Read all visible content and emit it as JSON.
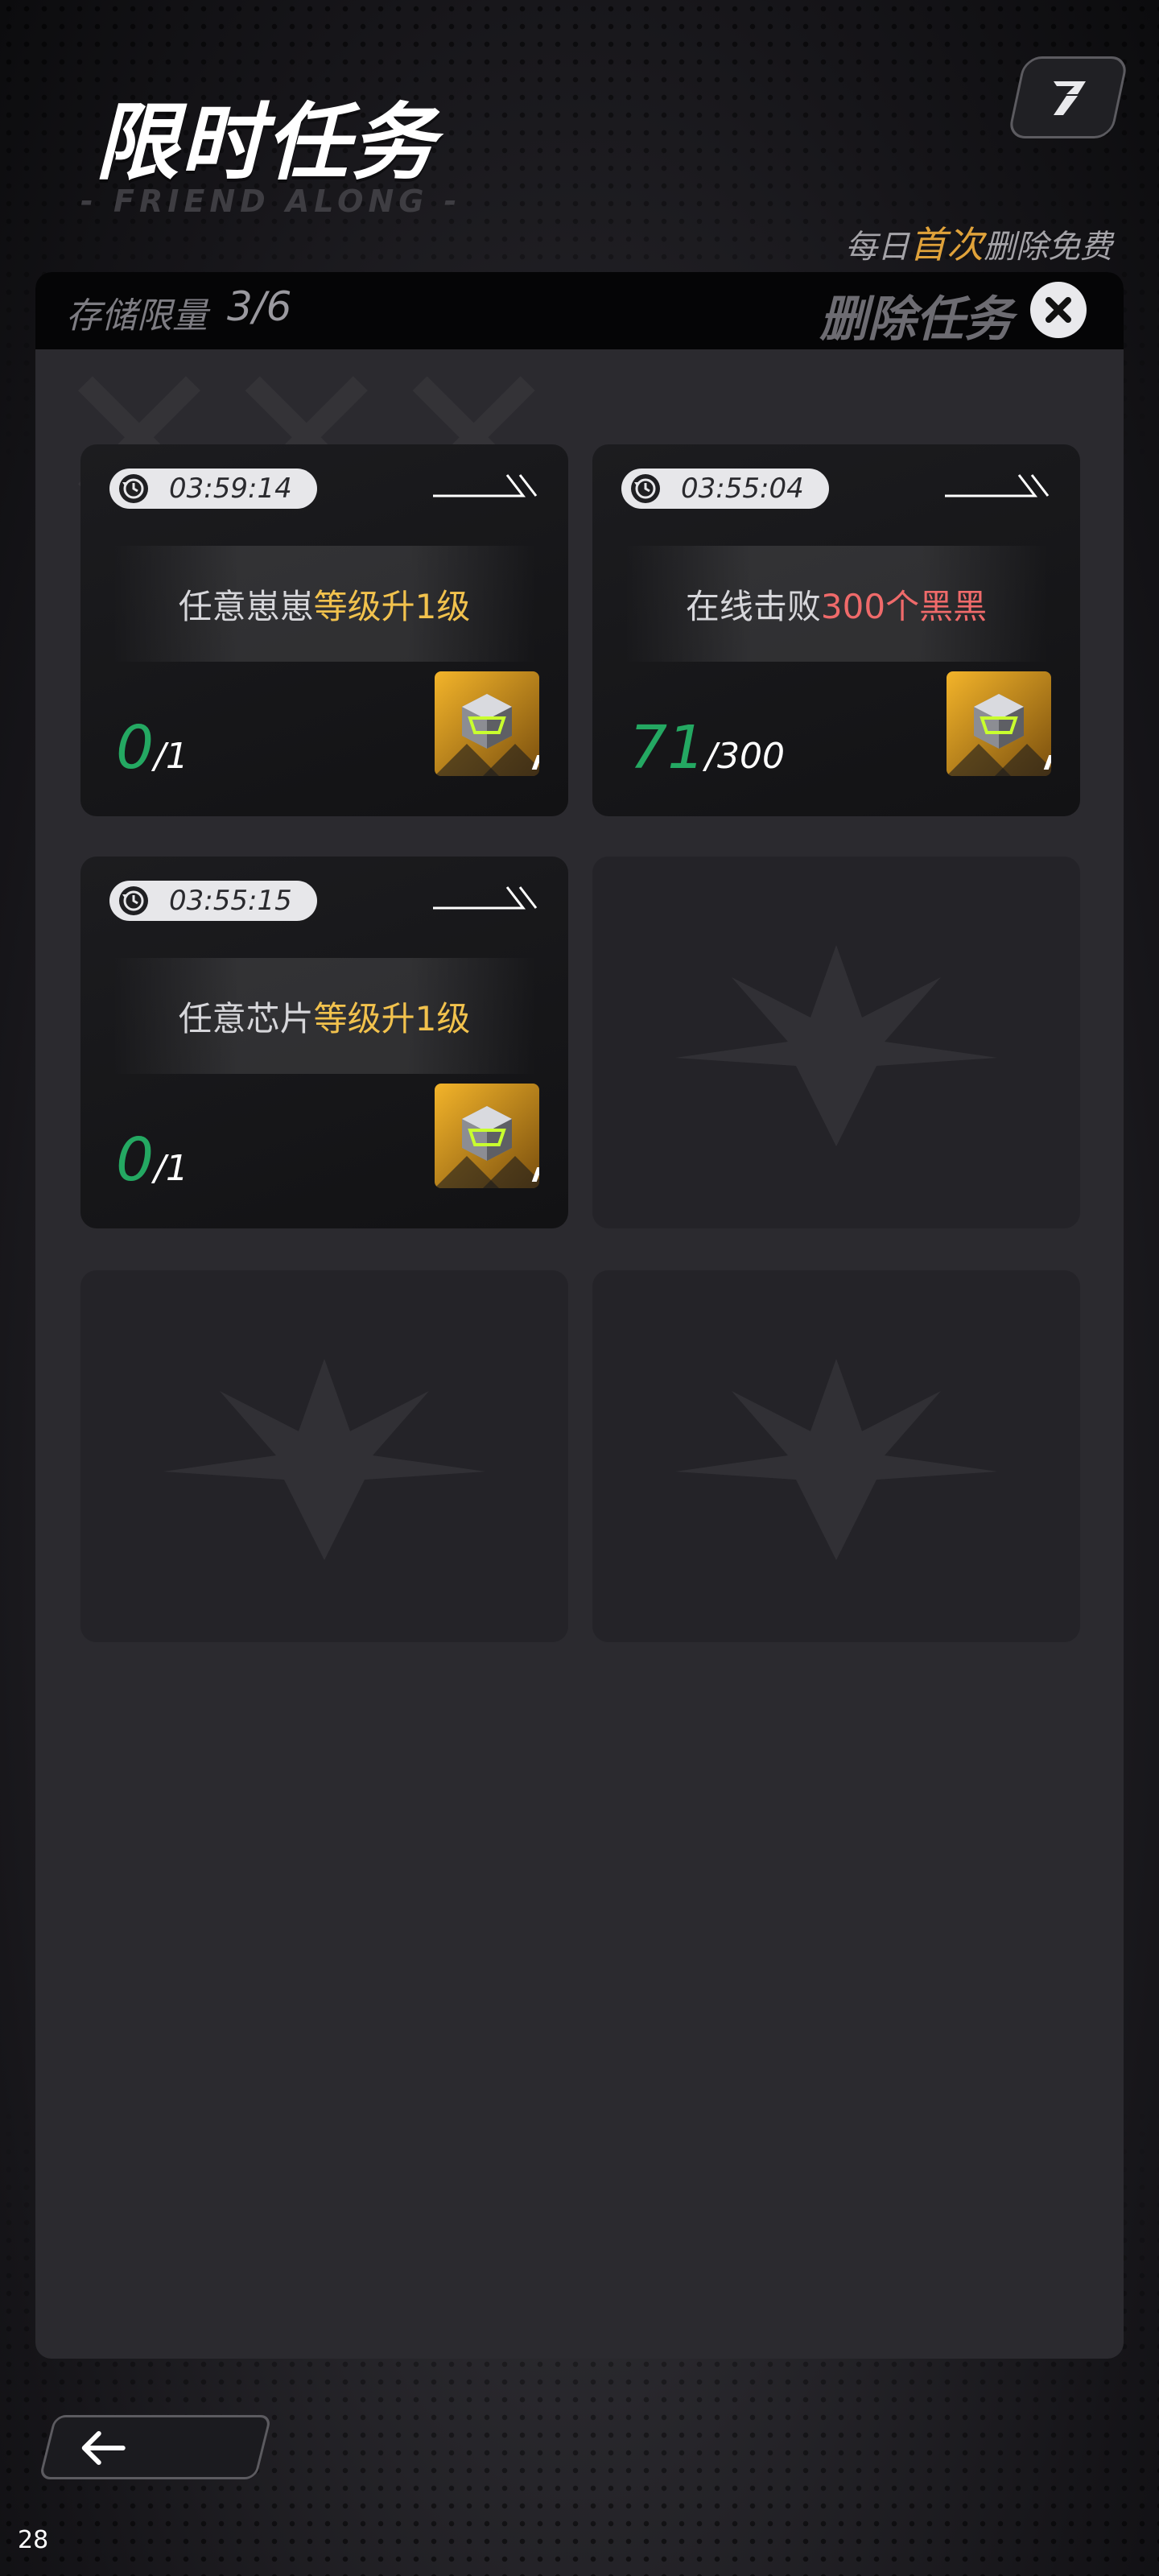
{
  "header": {
    "title": "限时任务",
    "subtitle": "- FRIEND ALONG -",
    "corner_icon": "swap-icon",
    "free_note_prefix": "每日",
    "free_note_highlight": "首次",
    "free_note_suffix": "删除免费"
  },
  "storage": {
    "label": "存储限量",
    "value": "3/6",
    "delete_label": "删除任务",
    "delete_icon": "close-icon"
  },
  "tasks": [
    {
      "timer": "03:59:14",
      "text_plain": "任意崽崽",
      "text_highlight": "等级升1级",
      "highlight_color": "#f2c24d",
      "progress_current": "0",
      "progress_sep": "/",
      "progress_total": "1",
      "reward_icon": "cube-chest-icon"
    },
    {
      "timer": "03:55:04",
      "text_plain": "在线击败",
      "text_highlight": "300个黑黑",
      "highlight_color": "#ef6a6a",
      "progress_current": "71",
      "progress_sep": "/",
      "progress_total": "300",
      "reward_icon": "cube-chest-icon"
    },
    {
      "timer": "03:55:15",
      "text_plain": "任意芯片",
      "text_highlight": "等级升1级",
      "highlight_color": "#f2c24d",
      "progress_current": "0",
      "progress_sep": "/",
      "progress_total": "1",
      "reward_icon": "cube-chest-icon"
    }
  ],
  "empty_slots": 3,
  "footer": {
    "back_icon": "arrow-left-icon",
    "page_number": "28"
  },
  "colors": {
    "accent_gold": "#e0a23a",
    "progress_green": "#24a862",
    "highlight_red": "#ef6a6a"
  }
}
